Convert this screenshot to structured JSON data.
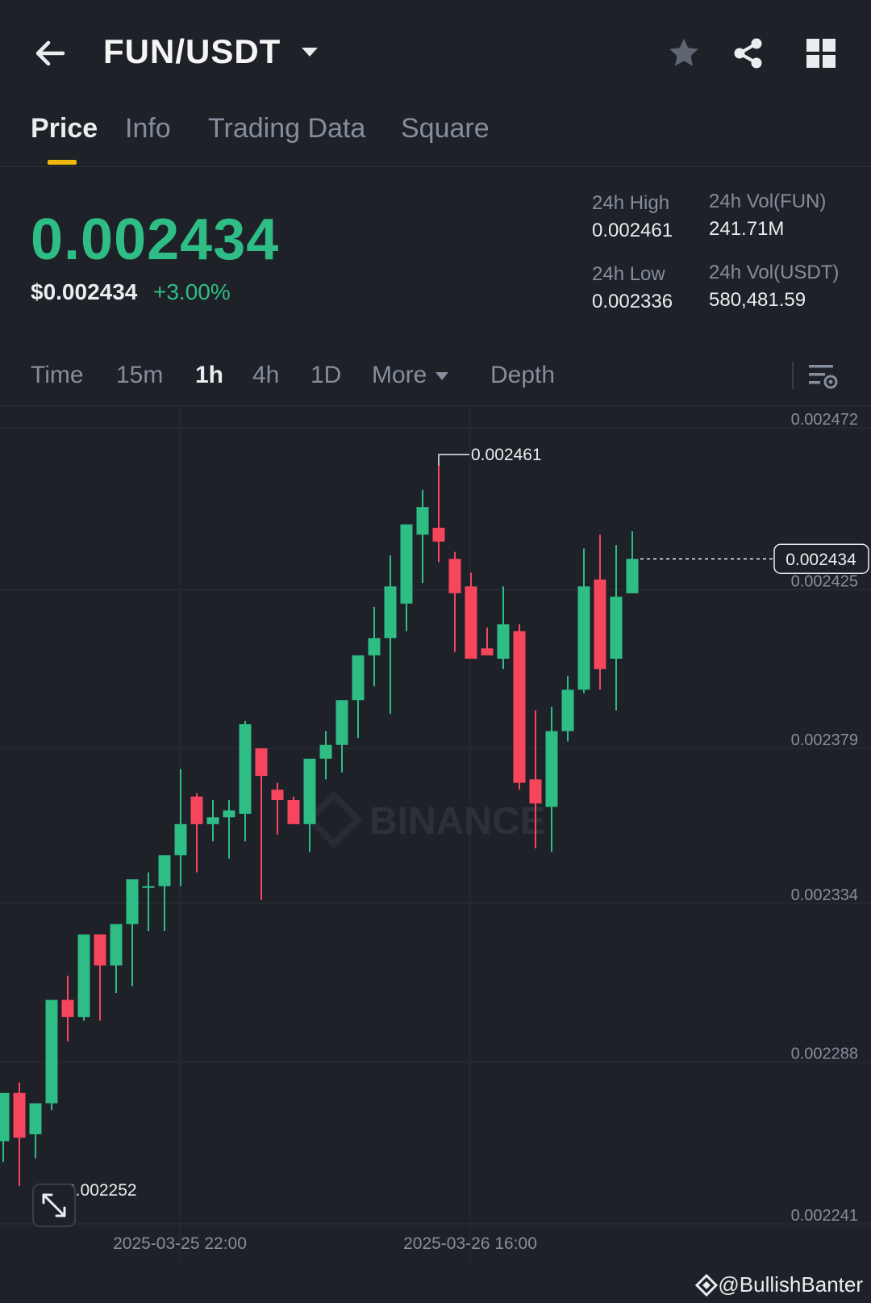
{
  "header": {
    "pair": "FUN/USDT"
  },
  "tabs": [
    {
      "label": "Price",
      "active": true
    },
    {
      "label": "Info",
      "active": false
    },
    {
      "label": "Trading Data",
      "active": false
    },
    {
      "label": "Square",
      "active": false
    }
  ],
  "ticker": {
    "last_price": "0.002434",
    "usd_price": "$0.002434",
    "change": "+3.00%",
    "high_label": "24h High",
    "high_value": "0.002461",
    "low_label": "24h Low",
    "low_value": "0.002336",
    "vol_base_label": "24h Vol(FUN)",
    "vol_base_value": "241.71M",
    "vol_quote_label": "24h Vol(USDT)",
    "vol_quote_value": "580,481.59"
  },
  "intervals": [
    {
      "label": "Time",
      "active": false
    },
    {
      "label": "15m",
      "active": false
    },
    {
      "label": "1h",
      "active": true
    },
    {
      "label": "4h",
      "active": false
    },
    {
      "label": "1D",
      "active": false
    },
    {
      "label": "More",
      "active": false
    },
    {
      "label": "Depth",
      "active": false
    }
  ],
  "colors": {
    "up": "#2ebd85",
    "down": "#f6465d",
    "accent": "#f0b90b",
    "bg": "#1f2128"
  },
  "watermark": "BINANCE",
  "credit": "@BullishBanter",
  "chart_data": {
    "type": "candlestick",
    "interval": "1h",
    "ylim": [
      0.002241,
      0.002472
    ],
    "y_ticks": [
      "0.002472",
      "0.002425",
      "0.002379",
      "0.002334",
      "0.002288",
      "0.002241"
    ],
    "x_ticks": [
      "2025-03-25 22:00",
      "2025-03-26 16:00"
    ],
    "last_price_label": "0.002434",
    "high_annotation": "0.002461",
    "low_annotation": "0.002252",
    "candles": [
      {
        "o": 0.002265,
        "h": 0.002278,
        "l": 0.002259,
        "c": 0.002279
      },
      {
        "o": 0.002279,
        "h": 0.002282,
        "l": 0.002252,
        "c": 0.002266
      },
      {
        "o": 0.002267,
        "h": 0.002276,
        "l": 0.00226,
        "c": 0.002276
      },
      {
        "o": 0.002276,
        "h": 0.002306,
        "l": 0.002274,
        "c": 0.002306
      },
      {
        "o": 0.002306,
        "h": 0.002313,
        "l": 0.002294,
        "c": 0.002301
      },
      {
        "o": 0.002301,
        "h": 0.002324,
        "l": 0.0023,
        "c": 0.002325
      },
      {
        "o": 0.002325,
        "h": 0.002325,
        "l": 0.0023,
        "c": 0.002316
      },
      {
        "o": 0.002316,
        "h": 0.002322,
        "l": 0.002308,
        "c": 0.002328
      },
      {
        "o": 0.002328,
        "h": 0.002334,
        "l": 0.00231,
        "c": 0.002341
      },
      {
        "o": 0.002339,
        "h": 0.002343,
        "l": 0.002326,
        "c": 0.002339
      },
      {
        "o": 0.002339,
        "h": 0.002348,
        "l": 0.002326,
        "c": 0.002348
      },
      {
        "o": 0.002348,
        "h": 0.002373,
        "l": 0.002339,
        "c": 0.002357
      },
      {
        "o": 0.002365,
        "h": 0.002366,
        "l": 0.002343,
        "c": 0.002357
      },
      {
        "o": 0.002357,
        "h": 0.002364,
        "l": 0.002352,
        "c": 0.002359
      },
      {
        "o": 0.002359,
        "h": 0.002364,
        "l": 0.002347,
        "c": 0.002361
      },
      {
        "o": 0.00236,
        "h": 0.002387,
        "l": 0.002352,
        "c": 0.002386
      },
      {
        "o": 0.002379,
        "h": 0.002379,
        "l": 0.002335,
        "c": 0.002371
      },
      {
        "o": 0.002367,
        "h": 0.002369,
        "l": 0.002354,
        "c": 0.002364
      },
      {
        "o": 0.002364,
        "h": 0.002365,
        "l": 0.002359,
        "c": 0.002357
      },
      {
        "o": 0.002357,
        "h": 0.002372,
        "l": 0.002349,
        "c": 0.002376
      },
      {
        "o": 0.002376,
        "h": 0.002384,
        "l": 0.00237,
        "c": 0.00238
      },
      {
        "o": 0.00238,
        "h": 0.002392,
        "l": 0.002372,
        "c": 0.002393
      },
      {
        "o": 0.002393,
        "h": 0.002399,
        "l": 0.002382,
        "c": 0.002406
      },
      {
        "o": 0.002406,
        "h": 0.00242,
        "l": 0.002397,
        "c": 0.002411
      },
      {
        "o": 0.002411,
        "h": 0.002435,
        "l": 0.002389,
        "c": 0.002426
      },
      {
        "o": 0.002421,
        "h": 0.002444,
        "l": 0.002413,
        "c": 0.002444
      },
      {
        "o": 0.002441,
        "h": 0.002454,
        "l": 0.002427,
        "c": 0.002449
      },
      {
        "o": 0.002443,
        "h": 0.002461,
        "l": 0.002433,
        "c": 0.002439
      },
      {
        "o": 0.002434,
        "h": 0.002436,
        "l": 0.002407,
        "c": 0.002424
      },
      {
        "o": 0.002426,
        "h": 0.00243,
        "l": 0.002406,
        "c": 0.002405
      },
      {
        "o": 0.002408,
        "h": 0.002414,
        "l": 0.002407,
        "c": 0.002406
      },
      {
        "o": 0.002405,
        "h": 0.002426,
        "l": 0.002402,
        "c": 0.002415
      },
      {
        "o": 0.002413,
        "h": 0.002415,
        "l": 0.002367,
        "c": 0.002369
      },
      {
        "o": 0.00237,
        "h": 0.00239,
        "l": 0.00235,
        "c": 0.002363
      },
      {
        "o": 0.002362,
        "h": 0.002391,
        "l": 0.002349,
        "c": 0.002384
      },
      {
        "o": 0.002384,
        "h": 0.0024,
        "l": 0.002381,
        "c": 0.002396
      },
      {
        "o": 0.002396,
        "h": 0.002437,
        "l": 0.002395,
        "c": 0.002426
      },
      {
        "o": 0.002428,
        "h": 0.002441,
        "l": 0.002396,
        "c": 0.002402
      },
      {
        "o": 0.002405,
        "h": 0.002438,
        "l": 0.00239,
        "c": 0.002423
      },
      {
        "o": 0.002424,
        "h": 0.002442,
        "l": 0.002425,
        "c": 0.002434
      }
    ]
  }
}
